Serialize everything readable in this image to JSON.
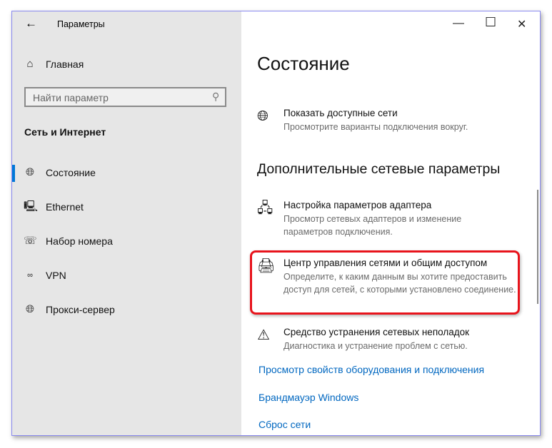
{
  "window": {
    "title": "Параметры",
    "back": "←",
    "minimize": "—",
    "maximize": "☐",
    "close": "✕"
  },
  "sidebar": {
    "home": "Главная",
    "search_placeholder": "Найти параметр",
    "section": "Сеть и Интернет",
    "items": [
      {
        "label": "Состояние",
        "icon": "globe-monitor-icon",
        "selected": true
      },
      {
        "label": "Ethernet",
        "icon": "ethernet-icon"
      },
      {
        "label": "Набор номера",
        "icon": "dialup-phone-icon"
      },
      {
        "label": "VPN",
        "icon": "vpn-icon"
      },
      {
        "label": "Прокси-сервер",
        "icon": "globe-icon"
      }
    ]
  },
  "main": {
    "title": "Состояние",
    "show_networks": {
      "title": "Показать доступные сети",
      "desc": "Просмотрите варианты подключения вокруг."
    },
    "advanced_heading": "Дополнительные сетевые параметры",
    "items": [
      {
        "title": "Настройка параметров адаптера",
        "desc": "Просмотр сетевых адаптеров и изменение параметров подключения."
      },
      {
        "title": "Центр управления сетями и общим доступом",
        "desc": "Определите, к каким данным вы хотите предоставить доступ для сетей, с которыми установлено соединение.",
        "highlighted": true
      },
      {
        "title": "Средство устранения сетевых неполадок",
        "desc": "Диагностика и устранение проблем с сетью."
      }
    ],
    "links": [
      "Просмотр свойств оборудования и подключения",
      "Брандмауэр Windows",
      "Сброс сети"
    ]
  },
  "colors": {
    "accent": "#0078d7",
    "link": "#0067c0",
    "highlight": "#e8141c"
  }
}
